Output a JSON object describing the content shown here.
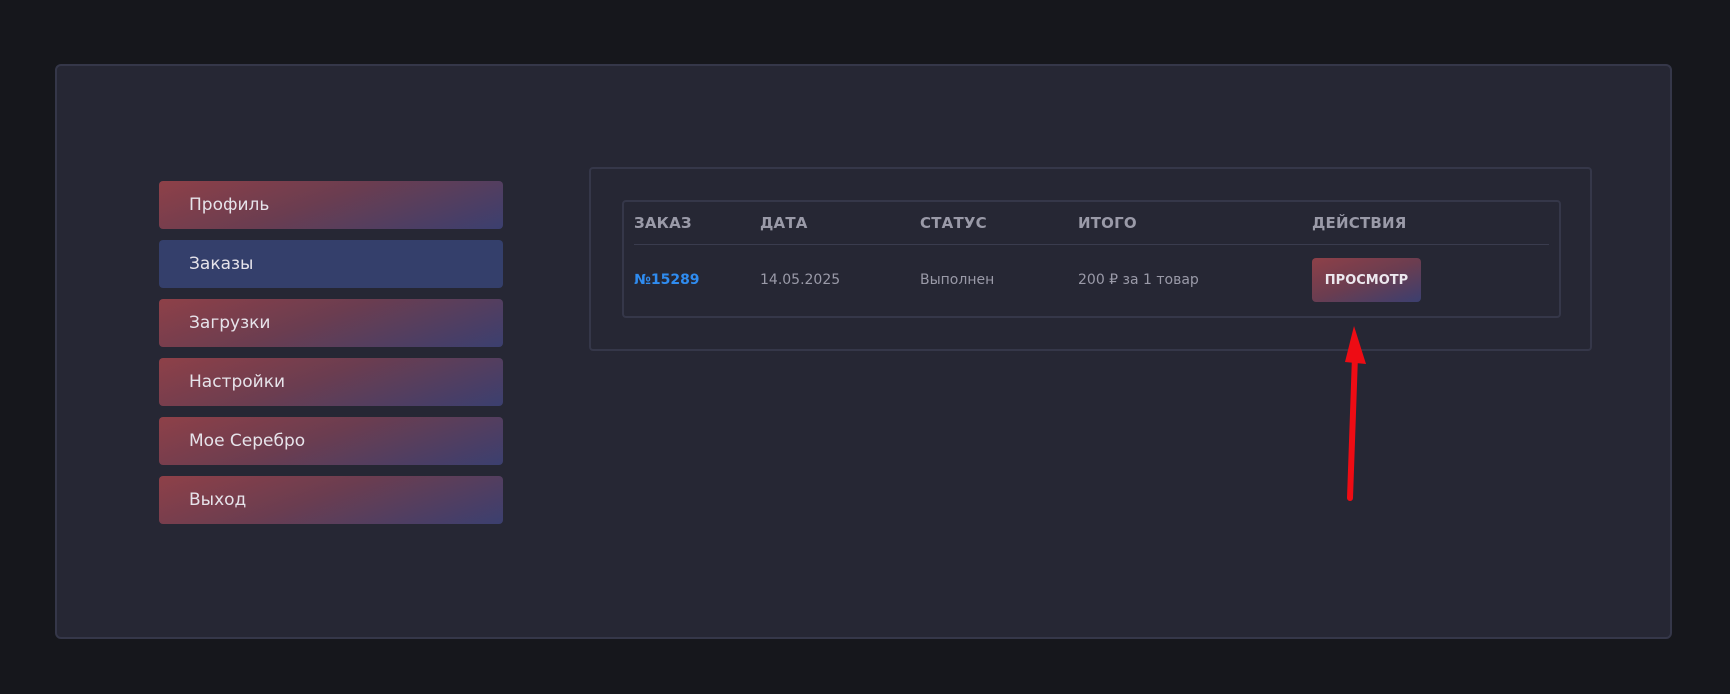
{
  "nav": {
    "items": [
      {
        "label": "Профиль",
        "active": false
      },
      {
        "label": "Заказы",
        "active": true
      },
      {
        "label": "Загрузки",
        "active": false
      },
      {
        "label": "Настройки",
        "active": false
      },
      {
        "label": "Мое Серебро",
        "active": false
      },
      {
        "label": "Выход",
        "active": false
      }
    ]
  },
  "orders": {
    "headers": {
      "order": "ЗАКАЗ",
      "date": "ДАТА",
      "status": "СТАТУС",
      "total": "ИТОГО",
      "actions": "ДЕЙСТВИЯ"
    },
    "rows": [
      {
        "number": "№15289",
        "date": "14.05.2025",
        "status": "Выполнен",
        "total": "200 ₽ за 1 товар",
        "action_label": "ПРОСМОТР"
      }
    ]
  },
  "colors": {
    "background": "#16171c",
    "panel": "#262734",
    "link": "#2f8cf0",
    "nav_active": "#343f6b",
    "annotation_arrow": "#ee0c14"
  },
  "annotation": {
    "icon": "red-arrow-up-icon"
  }
}
